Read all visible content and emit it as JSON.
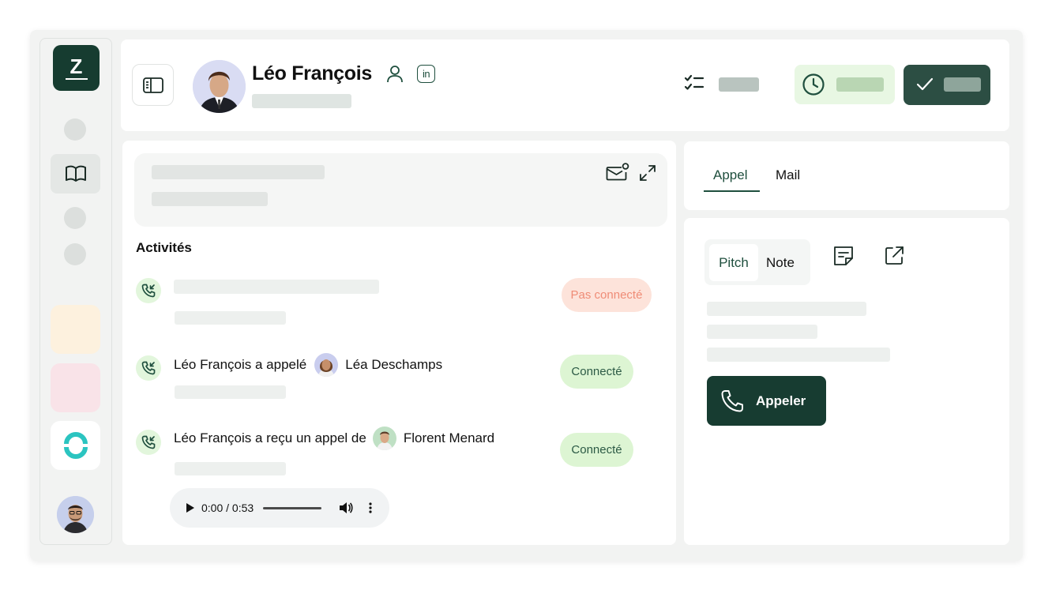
{
  "sidebar": {
    "logo_letter": "Z",
    "icons": [
      "book-icon",
      "refresh-icon"
    ]
  },
  "header": {
    "contact_name": "Léo François",
    "linkedin_label": "in",
    "icons": [
      "sidebar-toggle-icon",
      "person-icon",
      "linkedin-icon",
      "checklist-icon",
      "clock-icon",
      "check-icon"
    ]
  },
  "activities": {
    "title": "Activités",
    "items": [
      {
        "status": "Pas connecté"
      },
      {
        "caller": "Léo François a appelé",
        "person": "Léa Deschamps",
        "status": "Connecté"
      },
      {
        "caller": "Léo François a reçu un appel de",
        "person": "Florent Menard",
        "status": "Connecté"
      }
    ],
    "audio": {
      "time": "0:00 / 0:53"
    }
  },
  "right_tabs": {
    "tabs": [
      "Appel",
      "Mail"
    ],
    "active": "Appel"
  },
  "call_panel": {
    "segments": [
      "Pitch",
      "Note"
    ],
    "active_segment": "Pitch",
    "call_button": "Appeler",
    "icons": [
      "note-icon",
      "external-link-icon",
      "phone-icon"
    ]
  },
  "colors": {
    "brand_dark": "#163c30",
    "connected_bg": "#ddf5d3",
    "not_connected_bg": "#fde3da",
    "not_connected_text": "#ef8c76"
  }
}
